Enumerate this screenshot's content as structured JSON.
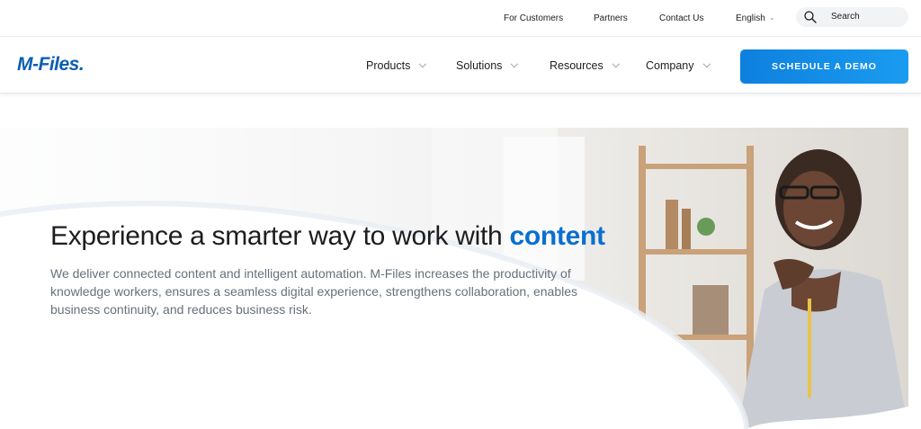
{
  "utility": {
    "links": [
      "For Customers",
      "Partners",
      "Contact Us"
    ],
    "language": "English",
    "search_label": "Search"
  },
  "nav": {
    "logo": "M-Files",
    "items": [
      "Products",
      "Solutions",
      "Resources",
      "Company"
    ],
    "cta": "SCHEDULE A DEMO"
  },
  "hero": {
    "headline_prefix": "Experience a smarter way to work with ",
    "headline_accent": "content",
    "subtext": "We deliver connected content and intelligent automation. M-Files increases the productivity of knowledge workers, ensures a seamless digital experience, strengthens collaboration, enables business continuity, and reduces business risk.",
    "image_alt": "woman-smiling-at-desk"
  },
  "colors": {
    "brand": "#0a5eb5",
    "accent": "#0a6fd0",
    "cta_start": "#0e80df",
    "cta_end": "#1a9cf0"
  }
}
